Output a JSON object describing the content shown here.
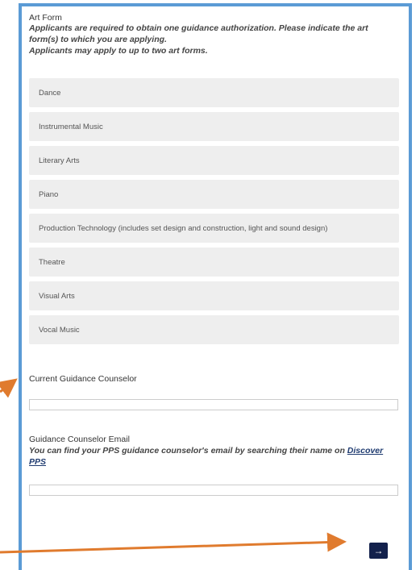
{
  "art_form": {
    "label": "Art Form",
    "description_1": "Applicants are required to obtain one guidance authorization. Please indicate the art form(s) to which you are applying.",
    "description_2": "Applicants may apply to up to two art forms.",
    "options": [
      "Dance",
      "Instrumental Music",
      "Literary Arts",
      "Piano",
      "Production Technology (includes set design and construction, light and sound design)",
      "Theatre",
      "Visual Arts",
      "Vocal Music"
    ]
  },
  "counselor": {
    "label": "Current Guidance Counselor",
    "value": ""
  },
  "email": {
    "label": "Guidance Counselor Email",
    "description": "You can find your PPS guidance counselor's email by searching their name on ",
    "link_text": "Discover PPS",
    "value": ""
  },
  "next_button": {
    "label": "→"
  },
  "colors": {
    "frame": "#5b9bd5",
    "arrow": "#e07b2e",
    "button": "#13214c"
  }
}
